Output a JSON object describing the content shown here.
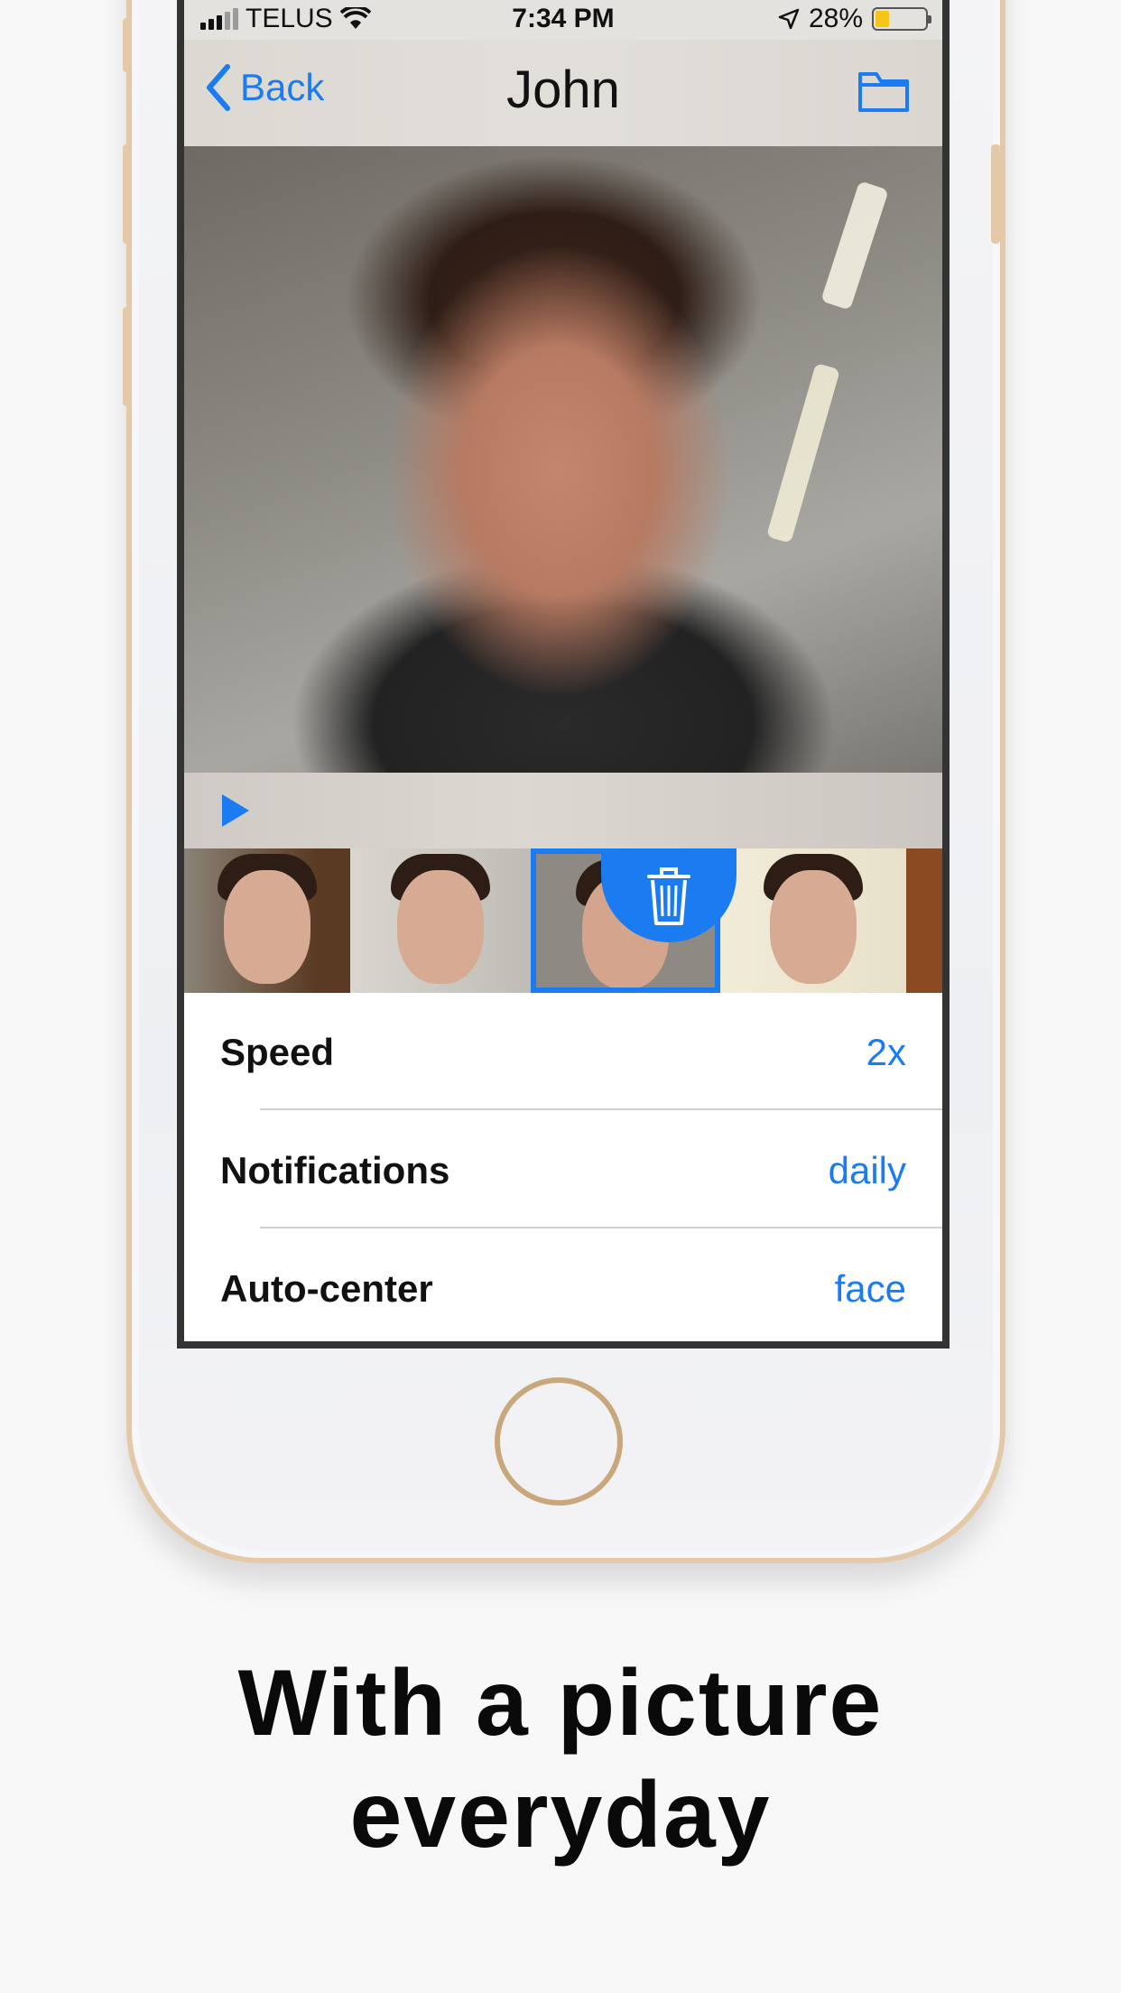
{
  "status_bar": {
    "carrier": "TELUS",
    "time": "7:34 PM",
    "battery_percent": "28%",
    "battery_level": 0.28
  },
  "nav": {
    "back_label": "Back",
    "title": "John",
    "folder_icon": "folder-icon"
  },
  "player": {
    "play_icon": "play-icon"
  },
  "thumbnails": {
    "count": 4,
    "selected_index": 2,
    "delete_icon": "trash-icon"
  },
  "settings": [
    {
      "label": "Speed",
      "value": "2x"
    },
    {
      "label": "Notifications",
      "value": "daily"
    },
    {
      "label": "Auto-center",
      "value": "face"
    }
  ],
  "caption": {
    "line1": "With a picture",
    "line2": "everyday"
  },
  "colors": {
    "accent": "#1a7cf0",
    "phone_frame": "#e3c9a8"
  }
}
